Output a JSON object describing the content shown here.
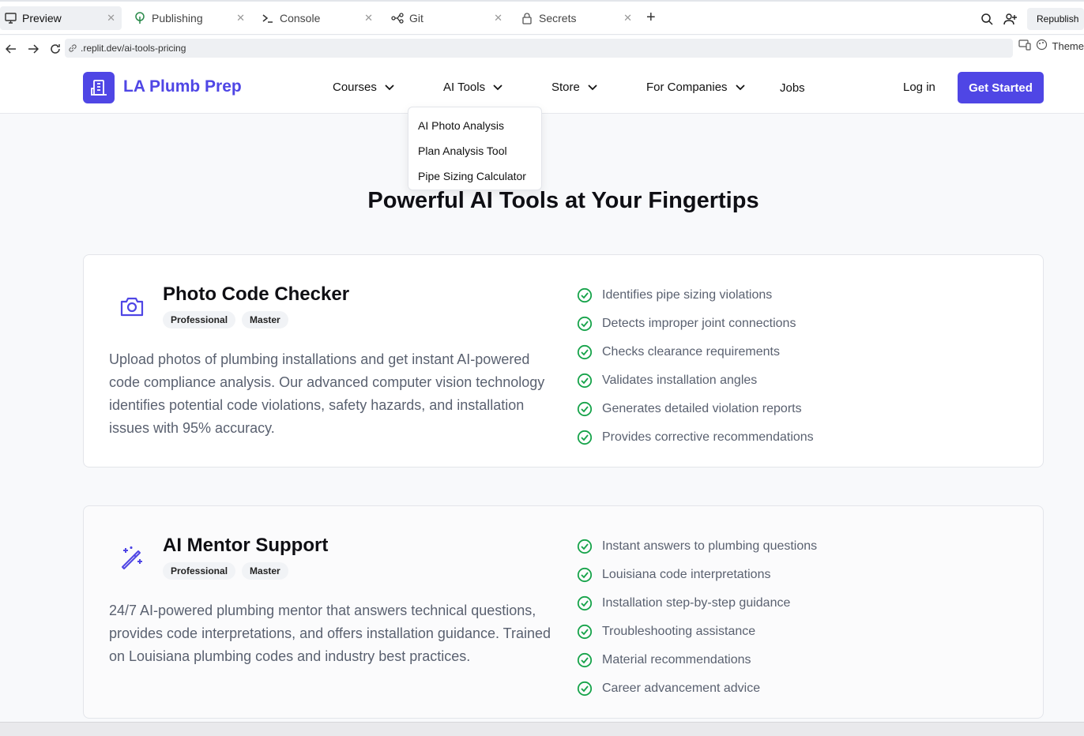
{
  "browser": {
    "tabs": [
      {
        "label": "Preview",
        "icon": "monitor-icon",
        "active": true
      },
      {
        "label": "Publishing",
        "icon": "publish-icon"
      },
      {
        "label": "Console",
        "icon": "terminal-icon"
      },
      {
        "label": "Git",
        "icon": "git-icon"
      },
      {
        "label": "Secrets",
        "icon": "lock-icon"
      }
    ],
    "republish_label": "Republish",
    "url": ".replit.dev/ai-tools-pricing",
    "theme_label": "Theme"
  },
  "site": {
    "brand": "LA Plumb Prep",
    "nav": [
      {
        "label": "Courses"
      },
      {
        "label": "AI Tools"
      },
      {
        "label": "Store"
      },
      {
        "label": "For Companies"
      },
      {
        "label": "Jobs"
      }
    ],
    "login": "Log in",
    "cta": "Get Started",
    "dropdown": [
      "AI Photo Analysis",
      "Plan Analysis Tool",
      "Pipe Sizing Calculator"
    ]
  },
  "main": {
    "heading": "Powerful AI Tools at Your Fingertips",
    "cards": [
      {
        "title": "Photo Code Checker",
        "icon": "camera-icon",
        "badges": [
          "Professional",
          "Master"
        ],
        "description": "Upload photos of plumbing installations and get instant AI-powered code compliance analysis. Our advanced computer vision technology identifies potential code violations, safety hazards, and installation issues with 95% accuracy.",
        "features": [
          "Identifies pipe sizing violations",
          "Detects improper joint connections",
          "Checks clearance requirements",
          "Validates installation angles",
          "Generates detailed violation reports",
          "Provides corrective recommendations"
        ]
      },
      {
        "title": "AI Mentor Support",
        "icon": "magic-wand-icon",
        "badges": [
          "Professional",
          "Master"
        ],
        "description": "24/7 AI-powered plumbing mentor that answers technical questions, provides code interpretations, and offers installation guidance. Trained on Louisiana plumbing codes and industry best practices.",
        "features": [
          "Instant answers to plumbing questions",
          "Louisiana code interpretations",
          "Installation step-by-step guidance",
          "Troubleshooting assistance",
          "Material recommendations",
          "Career advancement advice"
        ]
      }
    ]
  },
  "colors": {
    "brand": "#4f46e5",
    "check": "#16a34a",
    "muted_text": "#5a6170"
  }
}
